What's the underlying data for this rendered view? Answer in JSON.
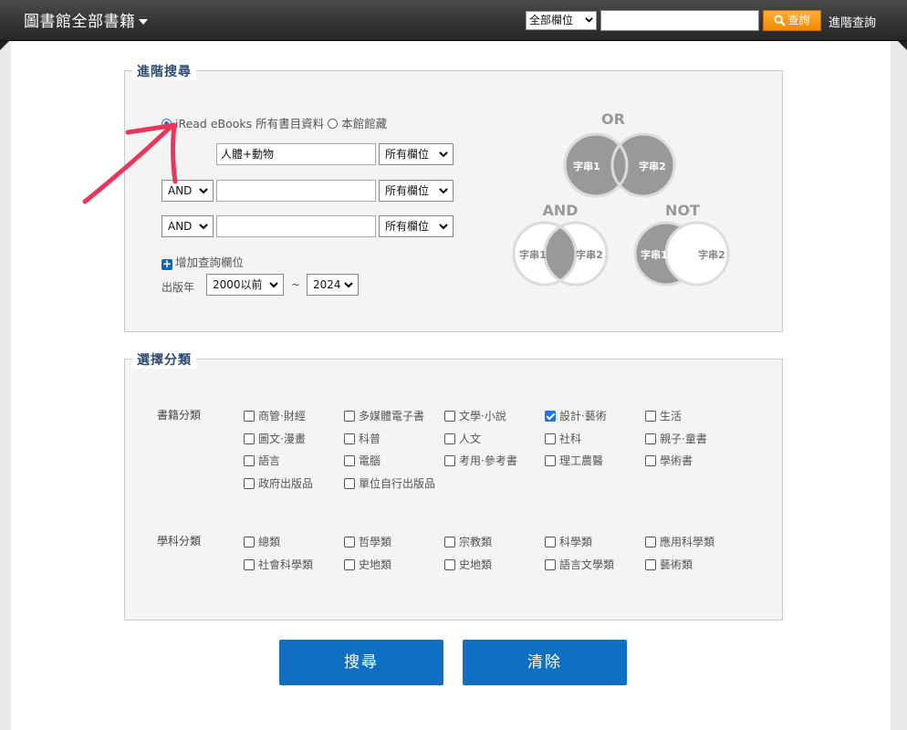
{
  "header": {
    "title": "圖書館全部書籍",
    "scope_select": "全部欄位",
    "search_btn": "查詢",
    "advanced_link": "進階查詢"
  },
  "advanced": {
    "legend": "進階搜尋",
    "source_options": [
      {
        "label": "iRead eBooks 所有書目資料",
        "selected": true
      },
      {
        "label": "本館館藏",
        "selected": false
      }
    ],
    "rows": [
      {
        "operator": "",
        "value": "人體+動物",
        "field": "所有欄位"
      },
      {
        "operator": "AND",
        "value": "",
        "field": "所有欄位"
      },
      {
        "operator": "AND",
        "value": "",
        "field": "所有欄位"
      }
    ],
    "add_field": "增加查詢欄位",
    "year_label": "出版年",
    "year_from": "2000以前",
    "year_sep": "~",
    "year_to": "2024"
  },
  "venn": {
    "or_label": "OR",
    "and_label": "AND",
    "not_label": "NOT",
    "term1": "字串1",
    "term2": "字串2",
    "fill": "#999999",
    "ring": "#dcdcdc"
  },
  "categories": {
    "legend": "選擇分類",
    "book_label": "書籍分類",
    "book_items": [
      {
        "label": "商管·財經",
        "checked": false
      },
      {
        "label": "多媒體電子書",
        "checked": false
      },
      {
        "label": "文學·小說",
        "checked": false
      },
      {
        "label": "設計·藝術",
        "checked": true
      },
      {
        "label": "生活",
        "checked": false
      },
      {
        "label": "圖文·漫畫",
        "checked": false
      },
      {
        "label": "科普",
        "checked": false
      },
      {
        "label": "人文",
        "checked": false
      },
      {
        "label": "社科",
        "checked": false
      },
      {
        "label": "親子·童書",
        "checked": false
      },
      {
        "label": "語言",
        "checked": false
      },
      {
        "label": "電腦",
        "checked": false
      },
      {
        "label": "考用·參考書",
        "checked": false
      },
      {
        "label": "理工農醫",
        "checked": false
      },
      {
        "label": "學術書",
        "checked": false
      },
      {
        "label": "政府出版品",
        "checked": false
      },
      {
        "label": "單位自行出版品",
        "checked": false
      }
    ],
    "subject_label": "學科分類",
    "subject_items": [
      {
        "label": "總類",
        "checked": false
      },
      {
        "label": "哲學類",
        "checked": false
      },
      {
        "label": "宗教類",
        "checked": false
      },
      {
        "label": "科學類",
        "checked": false
      },
      {
        "label": "應用科學類",
        "checked": false
      },
      {
        "label": "社會科學類",
        "checked": false
      },
      {
        "label": "史地類",
        "checked": false
      },
      {
        "label": "史地類",
        "checked": false
      },
      {
        "label": "語言文學類",
        "checked": false
      },
      {
        "label": "藝術類",
        "checked": false
      }
    ]
  },
  "actions": {
    "search": "搜尋",
    "clear": "清除"
  },
  "colors": {
    "accent": "#0f6fc2",
    "annotation": "#e8365d"
  }
}
